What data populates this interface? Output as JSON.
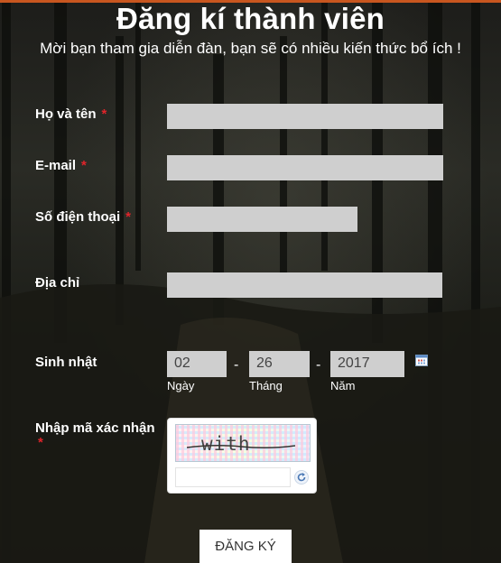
{
  "form": {
    "title": "Đăng kí thành viên",
    "subtitle": "Mời bạn tham gia diễn đàn, bạn sẽ có nhiều kiến thức bổ ích !",
    "required_mark": "*",
    "fields": {
      "fullname": {
        "label": "Họ và tên",
        "value": ""
      },
      "email": {
        "label": "E-mail",
        "value": ""
      },
      "phone": {
        "label": "Số điện thoại",
        "value": ""
      },
      "address": {
        "label": "Địa chỉ",
        "value": ""
      }
    },
    "birthday": {
      "label": "Sinh nhật",
      "day": "02",
      "month": "26",
      "year": "2017",
      "separator": "-",
      "day_caption": "Ngày",
      "month_caption": "Tháng",
      "year_caption": "Năm"
    },
    "captcha": {
      "label": "Nhập mã xác nhận",
      "word": "with",
      "value": ""
    },
    "submit_label": "ĐĂNG KÝ",
    "colors": {
      "input_bg": "#cfcfcf",
      "required": "#e0242a",
      "top_border": "#c8561f"
    },
    "icons": [
      "calendar-icon",
      "refresh-icon"
    ]
  }
}
